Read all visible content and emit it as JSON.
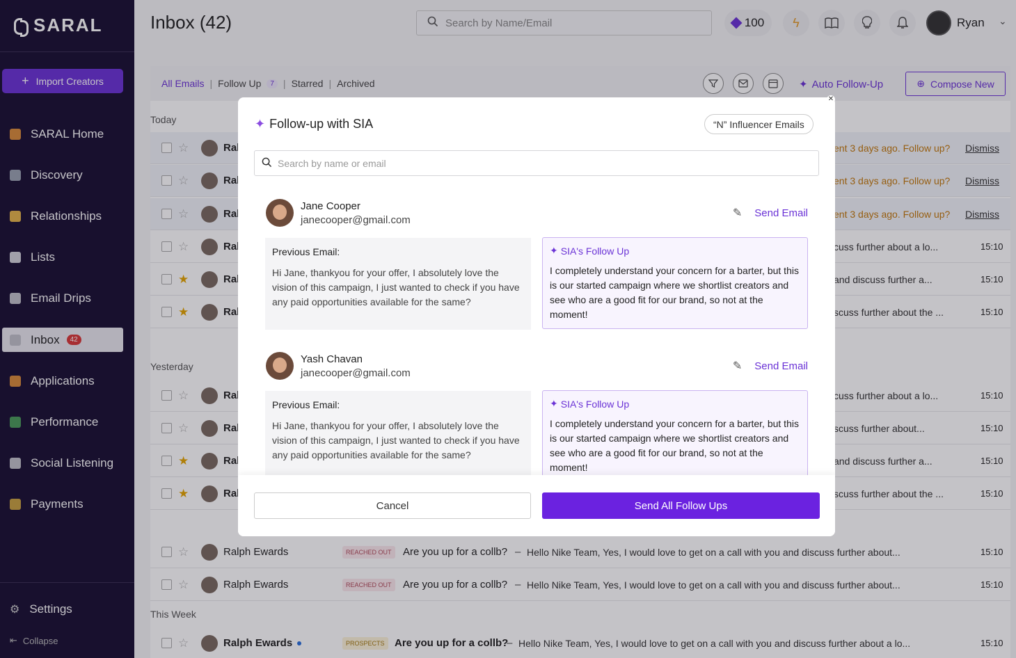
{
  "sidebar": {
    "logo": "SARAL",
    "import_button": "Import Creators",
    "items": [
      {
        "label": "SARAL Home",
        "icon": "home-icon",
        "color": "#d98b3a"
      },
      {
        "label": "Discovery",
        "icon": "magnifier-icon",
        "color": "#9aa2b0"
      },
      {
        "label": "Relationships",
        "icon": "handshake-icon",
        "color": "#e3b34a"
      },
      {
        "label": "Lists",
        "icon": "document-icon",
        "color": "#d0d0d8"
      },
      {
        "label": "Email Drips",
        "icon": "envelope-icon",
        "color": "#c0c0c8"
      },
      {
        "label": "Inbox",
        "icon": "inbox-icon",
        "color": "#c0c0c8",
        "badge": "42"
      },
      {
        "label": "Applications",
        "icon": "person-icon",
        "color": "#d98b3a"
      },
      {
        "label": "Performance",
        "icon": "bar-chart-icon",
        "color": "#4a9a5a"
      },
      {
        "label": "Social Listening",
        "icon": "envelope-icon",
        "color": "#c0c0c8"
      },
      {
        "label": "Payments",
        "icon": "money-bag-icon",
        "color": "#c7a040"
      }
    ],
    "settings": "Settings",
    "collapse": "Collapse"
  },
  "header": {
    "title": "Inbox (42)",
    "search_placeholder": "Search by Name/Email",
    "credits": "100",
    "user": "Ryan"
  },
  "toolbar": {
    "tabs": [
      "All Emails",
      "Follow Up",
      "Starred",
      "Archived"
    ],
    "follow_up_count": "7",
    "auto_follow_up": "Auto Follow-Up",
    "compose": "Compose New"
  },
  "groups": [
    "Today",
    "Yesterday",
    "This Week"
  ],
  "rows_partial": [
    {
      "name": "Ral",
      "star": false,
      "right": "ent 3 days ago. Follow up?",
      "dismiss": "Dismiss"
    },
    {
      "name": "Ral",
      "star": false,
      "right": "ent 3 days ago. Follow up?",
      "dismiss": "Dismiss"
    },
    {
      "name": "Ral",
      "star": false,
      "right": "ent 3 days ago. Follow up?",
      "dismiss": "Dismiss"
    },
    {
      "name": "Ral",
      "star": false,
      "right": "cuss further about a lo...",
      "time": "15:10"
    },
    {
      "name": "Ral",
      "star": true,
      "right": "and discuss further a...",
      "time": "15:10"
    },
    {
      "name": "Ral",
      "star": true,
      "right": "scuss further about the ...",
      "time": "15:10"
    },
    {
      "name": "Ral",
      "star": false,
      "right": "cuss further about a lo...",
      "time": "15:10"
    },
    {
      "name": "Ral",
      "star": false,
      "right": "scuss further about...",
      "time": "15:10"
    },
    {
      "name": "Ral",
      "star": true,
      "right": "and discuss further a...",
      "time": "15:10"
    },
    {
      "name": "Ral",
      "star": true,
      "right": "scuss further about the ...",
      "time": "15:10"
    }
  ],
  "rows_full": [
    {
      "name": "Ralph Ewards",
      "tag": "REACHED OUT",
      "subject": "Are you up for a collb?",
      "preview": "Hello Nike Team, Yes, I would love to get on a call with you and discuss further about...",
      "time": "15:10"
    },
    {
      "name": "Ralph Ewards",
      "tag": "REACHED OUT",
      "subject": "Are you up for a collb?",
      "preview": "Hello Nike Team, Yes, I would love to get on a call with you and discuss further about...",
      "time": "15:10"
    },
    {
      "name": "Ralph Ewards",
      "tag": "PROSPECTS",
      "subject": "Are you up for a collb?",
      "preview": "Hello Nike Team, Yes, I would love to get on a call with you and discuss further about a lo...",
      "time": "15:10"
    }
  ],
  "dash": "–",
  "modal": {
    "title": "Follow-up with SIA",
    "chip": "“N” Influencer Emails",
    "search_placeholder": "Search by name or email",
    "cards": [
      {
        "name": "Jane Cooper",
        "email": "janecooper@gmail.com",
        "send": "Send Email",
        "prev_label": "Previous Email:",
        "prev_text": "Hi Jane, thankyou for your offer, I absolutely love the vision of this campaign, I just wanted to check if you have any paid opportunities available for the same?",
        "sia_label": "SIA's Follow Up",
        "sia_text": "I completely understand your concern for a barter, but this is our started campaign where we shortlist creators and see who are a good fit for our brand, so not at the moment!"
      },
      {
        "name": "Yash Chavan",
        "email": "janecooper@gmail.com",
        "send": "Send Email",
        "prev_label": "Previous Email:",
        "prev_text": "Hi Jane, thankyou for your offer, I absolutely love the vision of this campaign, I just wanted to check if you have any paid opportunities available for the same?",
        "sia_label": "SIA's Follow Up",
        "sia_text": "I completely understand your concern for a barter, but this is our started campaign where we shortlist creators and see who are a good fit for our brand, so not at the moment!"
      }
    ],
    "cancel": "Cancel",
    "send_all": "Send All Follow Ups"
  },
  "colors": {
    "accent": "#6b33d6",
    "sidebar_bg": "#1a1033",
    "warning": "#c2790d"
  }
}
